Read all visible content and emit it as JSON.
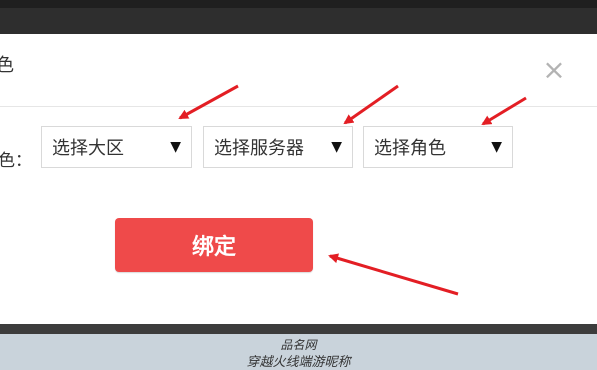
{
  "dialog": {
    "title_fragment": "色",
    "close_symbol": "×",
    "row_label": "色："
  },
  "selects": [
    {
      "value": "选择大区",
      "arrow": "▼"
    },
    {
      "value": "选择服务器",
      "arrow": "▼"
    },
    {
      "value": "选择角色",
      "arrow": "▼"
    }
  ],
  "bind_button": {
    "label": "绑定"
  },
  "watermark": {
    "line1": "品名网",
    "line2": "穿越火线端游昵称"
  },
  "colors": {
    "accent": "#ef4a4a",
    "annotation_arrow": "#e31e24"
  }
}
